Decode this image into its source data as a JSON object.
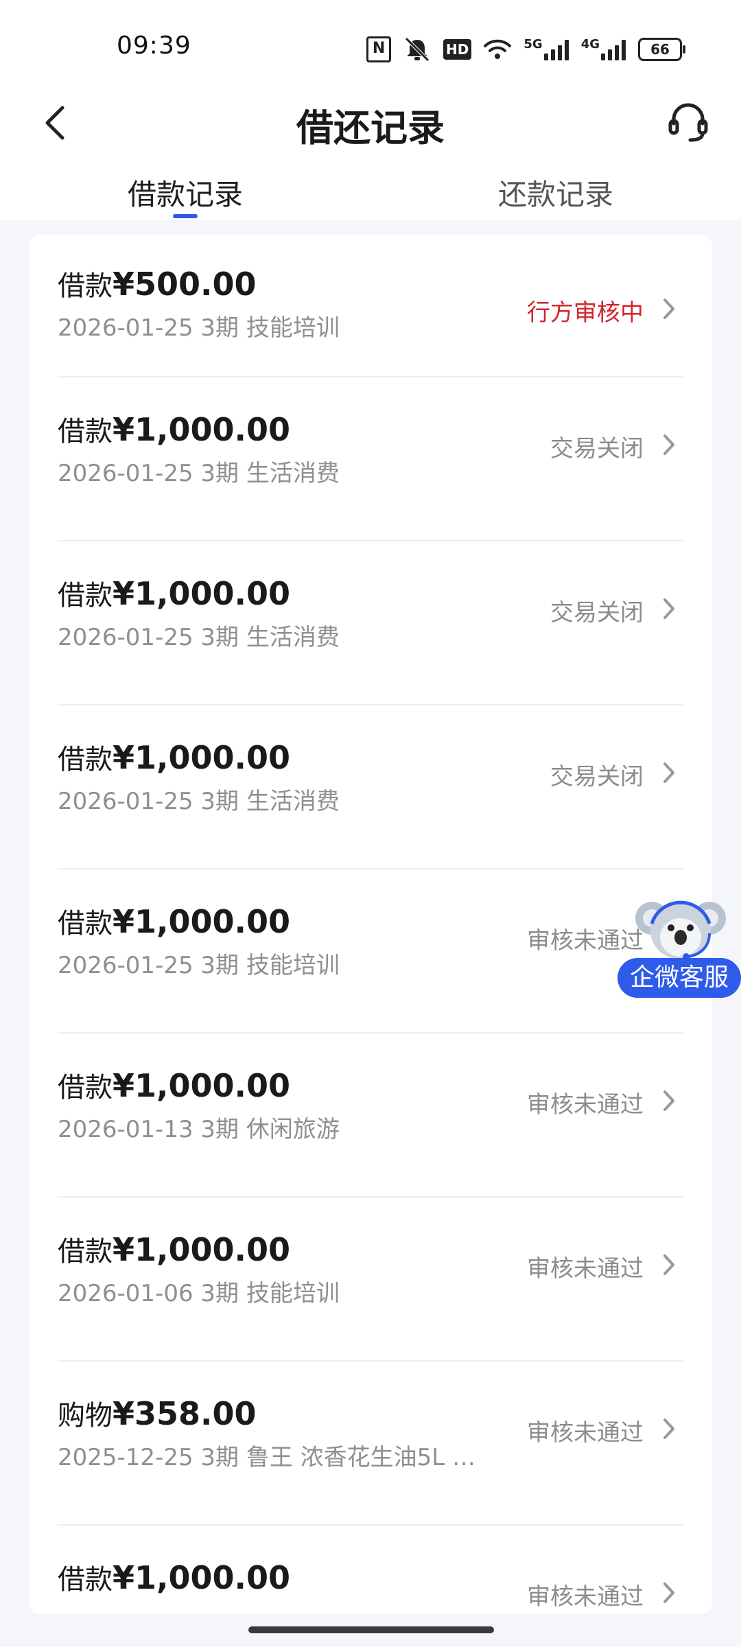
{
  "status_bar": {
    "time": "09:39",
    "net_5g": "5G",
    "net_4g": "4G",
    "hd_label": "HD",
    "nfc_label": "N",
    "battery": "66"
  },
  "header": {
    "title": "借还记录",
    "back_icon": "chevron-left-icon",
    "service_icon": "headset-icon"
  },
  "tabs": [
    {
      "label": "借款记录",
      "active": true
    },
    {
      "label": "还款记录",
      "active": false
    }
  ],
  "records": [
    {
      "type": "借款",
      "amount": "¥500.00",
      "meta": "2026-01-25 3期  技能培训",
      "status": "行方审核中",
      "status_color": "#d3252b"
    },
    {
      "type": "借款",
      "amount": "¥1,000.00",
      "meta": "2026-01-25 3期  生活消费",
      "status": "交易关闭",
      "status_color": "#8c8c8c"
    },
    {
      "type": "借款",
      "amount": "¥1,000.00",
      "meta": "2026-01-25 3期  生活消费",
      "status": "交易关闭",
      "status_color": "#8c8c8c"
    },
    {
      "type": "借款",
      "amount": "¥1,000.00",
      "meta": "2026-01-25 3期  生活消费",
      "status": "交易关闭",
      "status_color": "#8c8c8c"
    },
    {
      "type": "借款",
      "amount": "¥1,000.00",
      "meta": "2026-01-25 3期  技能培训",
      "status": "审核未通过",
      "status_color": "#8c8c8c"
    },
    {
      "type": "借款",
      "amount": "¥1,000.00",
      "meta": "2026-01-13 3期  休闲旅游",
      "status": "审核未通过",
      "status_color": "#8c8c8c"
    },
    {
      "type": "借款",
      "amount": "¥1,000.00",
      "meta": "2026-01-06 3期  技能培训",
      "status": "审核未通过",
      "status_color": "#8c8c8c"
    },
    {
      "type": "购物",
      "amount": "¥358.00",
      "meta": "2025-12-25 3期  鲁王 浓香花生油5L 10...",
      "status": "审核未通过",
      "status_color": "#8c8c8c"
    },
    {
      "type": "借款",
      "amount": "¥1,000.00",
      "meta": "",
      "status": "审核未通过",
      "status_color": "#8c8c8c"
    }
  ],
  "floating_service": {
    "label": "企微客服",
    "icon": "koala-mascot-icon"
  }
}
